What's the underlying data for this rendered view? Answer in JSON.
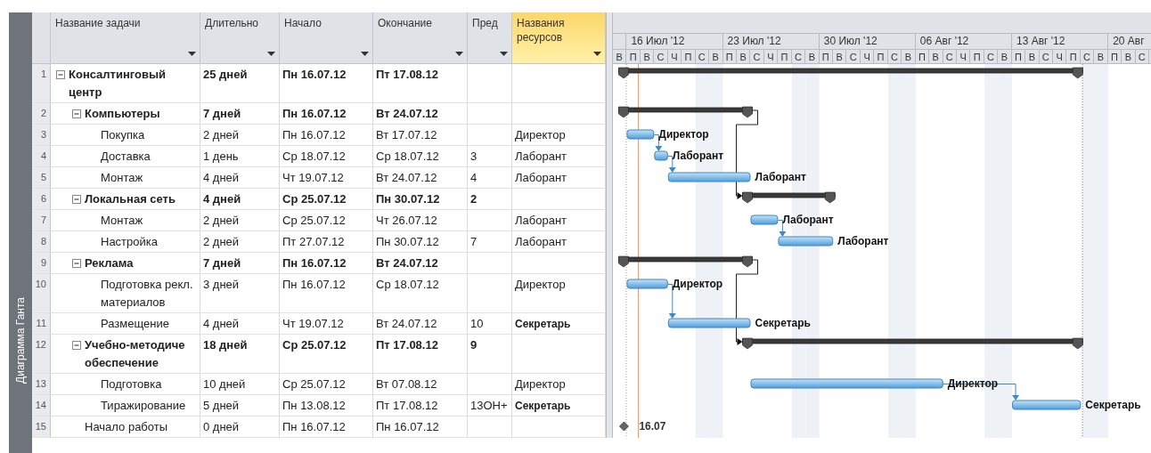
{
  "side_tab": {
    "label": "Диаграмма Ганта"
  },
  "table": {
    "columns": [
      {
        "label": "Название задачи",
        "highlighted": false
      },
      {
        "label": "Длительно",
        "highlighted": false
      },
      {
        "label": "Начало",
        "highlighted": false
      },
      {
        "label": "Окончание",
        "highlighted": false
      },
      {
        "label": "Пред",
        "highlighted": false
      },
      {
        "label": "Названия ресурсов",
        "highlighted": true
      }
    ],
    "tasks": [
      {
        "row": "1",
        "kind": "summary",
        "name": "Консалтинговый центр",
        "expanded": true,
        "duration": "25 дней",
        "start": "Пн 16.07.12",
        "finish": "Пт 17.08.12",
        "children": [
          {
            "row": "2",
            "kind": "summary",
            "name": "Компьютеры",
            "expanded": true,
            "duration": "7 дней",
            "start": "Пн 16.07.12",
            "finish": "Вт 24.07.12",
            "children": [
              {
                "row": "3",
                "kind": "task",
                "name": "Покупка",
                "duration": "2 дней",
                "start": "Пн 16.07.12",
                "finish": "Вт 17.07.12",
                "resources": "Директор",
                "resource_bold": false,
                "bar_label": "Директор"
              },
              {
                "row": "4",
                "kind": "task",
                "name": "Доставка",
                "duration": "1 день",
                "start": "Ср 18.07.12",
                "finish": "Ср 18.07.12",
                "predecessors": "3",
                "resources": "Лаборант",
                "resource_bold": false,
                "bar_label": "Лаборант"
              },
              {
                "row": "5",
                "kind": "task",
                "name": "Монтаж",
                "duration": "4 дней",
                "start": "Чт 19.07.12",
                "finish": "Вт 24.07.12",
                "predecessors": "4",
                "resources": "Лаборант",
                "resource_bold": false,
                "bar_label": "Лаборант"
              }
            ]
          },
          {
            "row": "6",
            "kind": "summary",
            "name": "Локальная сеть",
            "expanded": true,
            "duration": "4 дней",
            "start": "Ср 25.07.12",
            "finish": "Пн 30.07.12",
            "predecessors": "2",
            "children": [
              {
                "row": "7",
                "kind": "task",
                "name": "Монтаж",
                "duration": "2 дней",
                "start": "Ср 25.07.12",
                "finish": "Чт 26.07.12",
                "resources": "Лаборант",
                "resource_bold": false,
                "bar_label": "Лаборант"
              },
              {
                "row": "8",
                "kind": "task",
                "name": "Настройка",
                "duration": "2 дней",
                "start": "Пт 27.07.12",
                "finish": "Пн 30.07.12",
                "predecessors": "7",
                "resources": "Лаборант",
                "resource_bold": false,
                "bar_label": "Лаборант"
              }
            ]
          },
          {
            "row": "9",
            "kind": "summary",
            "name": "Реклама",
            "expanded": true,
            "duration": "7 дней",
            "start": "Пн 16.07.12",
            "finish": "Вт 24.07.12",
            "children": [
              {
                "row": "10",
                "kind": "task",
                "name": "Подготовка рекл. материалов",
                "duration": "3 дней",
                "start": "Пн 16.07.12",
                "finish": "Ср 18.07.12",
                "resources": "Директор",
                "resource_bold": false,
                "bar_label": "Директор"
              },
              {
                "row": "11",
                "kind": "task",
                "name": "Размещение",
                "duration": "4 дней",
                "start": "Чт 19.07.12",
                "finish": "Вт 24.07.12",
                "predecessors": "10",
                "resources": "Секретарь",
                "resource_bold": true,
                "bar_label": "Секретарь"
              }
            ]
          },
          {
            "row": "12",
            "kind": "summary",
            "name": "Учебно-методиче обеспечение",
            "expanded": true,
            "duration": "18 дней",
            "start": "Ср 25.07.12",
            "finish": "Пт 17.08.12",
            "predecessors": "9",
            "children": [
              {
                "row": "13",
                "kind": "task",
                "name": "Подготовка",
                "duration": "10 дней",
                "start": "Ср 25.07.12",
                "finish": "Вт 07.08.12",
                "resources": "Директор",
                "resource_bold": false,
                "bar_label": "Директор"
              },
              {
                "row": "14",
                "kind": "task",
                "name": "Тиражирование",
                "duration": "5 дней",
                "start": "Пн 13.08.12",
                "finish": "Пт 17.08.12",
                "predecessors": "13ОН+",
                "resources": "Секретарь",
                "resource_bold": true,
                "bar_label": "Секретарь"
              }
            ]
          },
          {
            "row": "15",
            "kind": "milestone",
            "name": "Начало работы",
            "duration": "0 дней",
            "start": "Пн 16.07.12",
            "finish": "Пн 16.07.12",
            "bar_label": "16.07"
          }
        ]
      }
    ]
  },
  "timeline": {
    "weeks": [
      "16 Июл '12",
      "23 Июл '12",
      "30 Июл '12",
      "06 Авг '12",
      "13 Авг '12",
      "20 Авг"
    ],
    "days": [
      "В",
      "П",
      "В",
      "С",
      "Ч",
      "П",
      "С",
      "В",
      "П",
      "В",
      "С",
      "Ч",
      "П",
      "С",
      "В",
      "П",
      "В",
      "С",
      "Ч",
      "П",
      "С",
      "В",
      "П",
      "В",
      "С",
      "Ч",
      "П",
      "С",
      "В",
      "П",
      "В",
      "С",
      "Ч",
      "П",
      "С",
      "В",
      "П",
      "В",
      "С"
    ]
  }
}
